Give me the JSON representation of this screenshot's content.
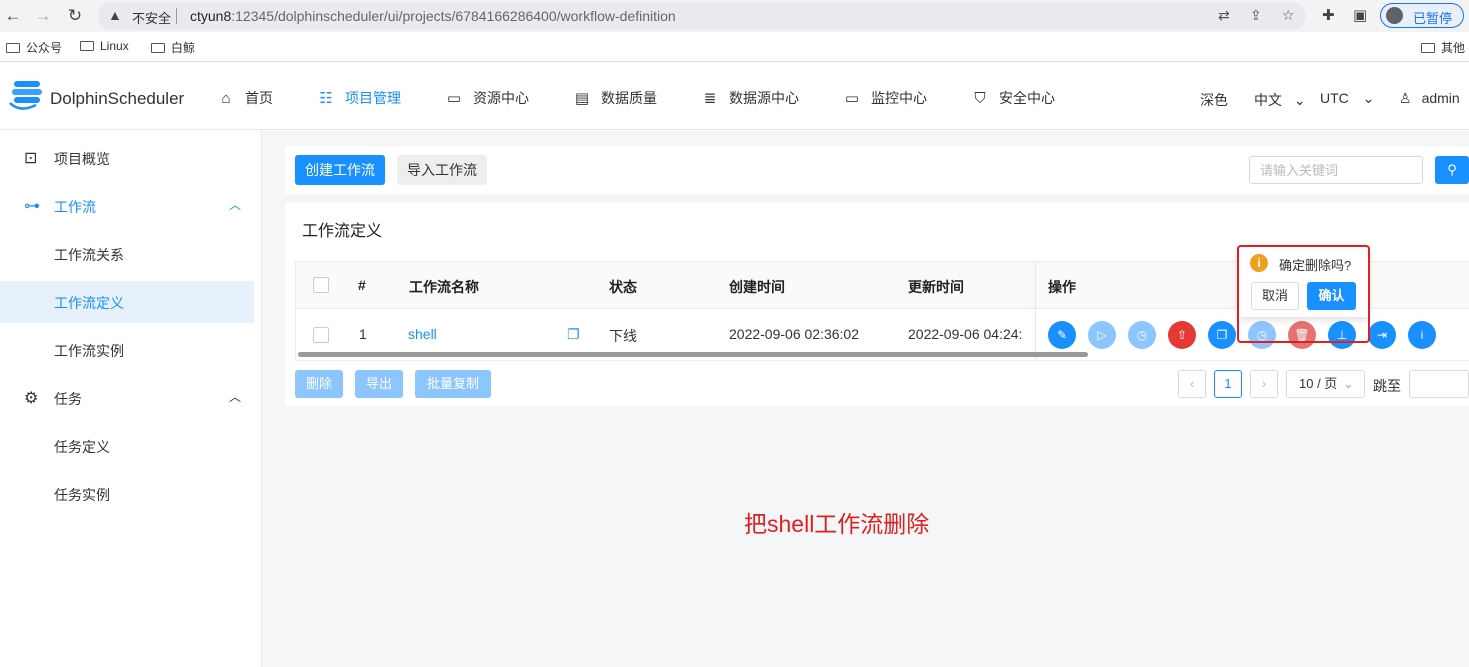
{
  "browser": {
    "insecure_label": "不安全",
    "url_host": "ctyun8",
    "url_rest": ":12345/dolphinscheduler/ui/projects/6784166286400/workflow-definition",
    "paused_label": "已暂停",
    "bookmarks": [
      "公众号",
      "Linux",
      "白鲸"
    ],
    "other_bookmarks": "其他"
  },
  "header": {
    "logo_text": "DolphinScheduler",
    "nav": [
      {
        "label": "首页",
        "icon": "home-icon"
      },
      {
        "label": "项目管理",
        "icon": "project-icon",
        "active": true
      },
      {
        "label": "资源中心",
        "icon": "folder-icon"
      },
      {
        "label": "数据质量",
        "icon": "document-icon"
      },
      {
        "label": "数据源中心",
        "icon": "database-icon"
      },
      {
        "label": "监控中心",
        "icon": "monitor-icon"
      },
      {
        "label": "安全中心",
        "icon": "shield-icon"
      }
    ],
    "theme": "深色",
    "language": "中文",
    "timezone": "UTC",
    "user": "admin"
  },
  "sidebar": {
    "items": [
      {
        "label": "项目概览"
      },
      {
        "label": "工作流"
      },
      {
        "label": "工作流关系"
      },
      {
        "label": "工作流定义"
      },
      {
        "label": "工作流实例"
      },
      {
        "label": "任务"
      },
      {
        "label": "任务定义"
      },
      {
        "label": "任务实例"
      }
    ]
  },
  "toolbar": {
    "create_label": "创建工作流",
    "import_label": "导入工作流",
    "search_placeholder": "请输入关键词"
  },
  "table": {
    "title": "工作流定义",
    "columns": [
      "#",
      "工作流名称",
      "状态",
      "创建时间",
      "更新时间",
      "操作"
    ],
    "rows": [
      {
        "index": "1",
        "name": "shell",
        "status": "下线",
        "created": "2022-09-06 02:36:02",
        "updated": "2022-09-06 04:24:"
      }
    ]
  },
  "bulk": {
    "delete_label": "删除",
    "export_label": "导出",
    "copy_label": "批量复制"
  },
  "pagination": {
    "current": "1",
    "page_size": "10 / 页",
    "jump_label": "跳至"
  },
  "popconfirm": {
    "icon": "i",
    "text": "确定删除吗?",
    "cancel_label": "取消",
    "ok_label": "确认"
  },
  "annotation": "把shell工作流删除",
  "colors": {
    "primary": "#1890ff",
    "danger": "#e53935",
    "warning": "#f0a020",
    "annotation": "#e02020"
  }
}
